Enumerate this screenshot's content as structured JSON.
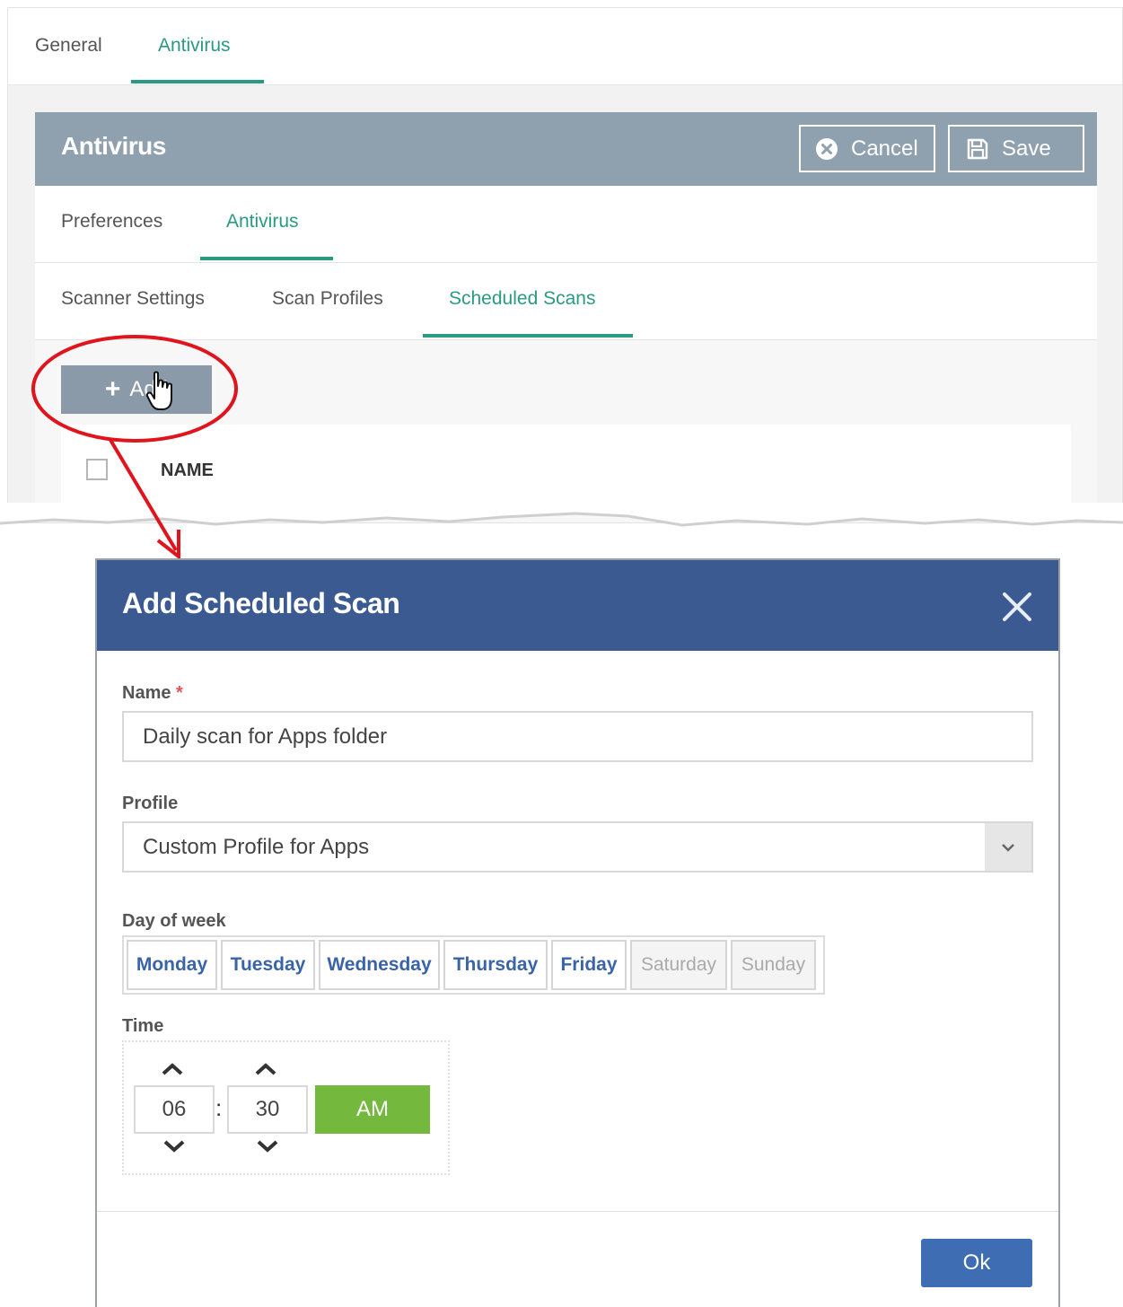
{
  "top_tabs": [
    {
      "label": "General",
      "active": false
    },
    {
      "label": "Antivirus",
      "active": true
    }
  ],
  "panel": {
    "title": "Antivirus",
    "cancel_label": "Cancel",
    "save_label": "Save"
  },
  "sub_tabs": [
    {
      "label": "Preferences",
      "active": false
    },
    {
      "label": "Antivirus",
      "active": true
    }
  ],
  "section_tabs": [
    {
      "label": "Scanner Settings",
      "active": false
    },
    {
      "label": "Scan Profiles",
      "active": false
    },
    {
      "label": "Scheduled Scans",
      "active": true
    }
  ],
  "list": {
    "add_label": "Add",
    "columns": [
      "NAME"
    ]
  },
  "dialog": {
    "title": "Add Scheduled Scan",
    "name_label": "Name",
    "required_mark": "*",
    "name_value": "Daily scan for Apps folder",
    "profile_label": "Profile",
    "profile_value": "Custom Profile for Apps",
    "day_label": "Day of week",
    "days": [
      {
        "label": "Monday",
        "selected": true
      },
      {
        "label": "Tuesday",
        "selected": true
      },
      {
        "label": "Wednesday",
        "selected": true
      },
      {
        "label": "Thursday",
        "selected": true
      },
      {
        "label": "Friday",
        "selected": true
      },
      {
        "label": "Saturday",
        "selected": false
      },
      {
        "label": "Sunday",
        "selected": false
      }
    ],
    "time_label": "Time",
    "hour": "06",
    "minute": "30",
    "separator": ":",
    "meridiem": "AM",
    "ok_label": "Ok"
  },
  "colors": {
    "accent_green": "#2a9a83",
    "panel_header": "#8fa0ae",
    "dialog_header": "#3c5a92",
    "ok_button": "#3e6db4",
    "ampm_button": "#74b83e",
    "annotation_red": "#e0141c"
  },
  "icons": [
    "cancel-circle-x-icon",
    "save-floppy-icon",
    "plus-icon",
    "hand-pointer-icon",
    "close-icon",
    "chevron-down-icon",
    "chevron-up-icon"
  ]
}
